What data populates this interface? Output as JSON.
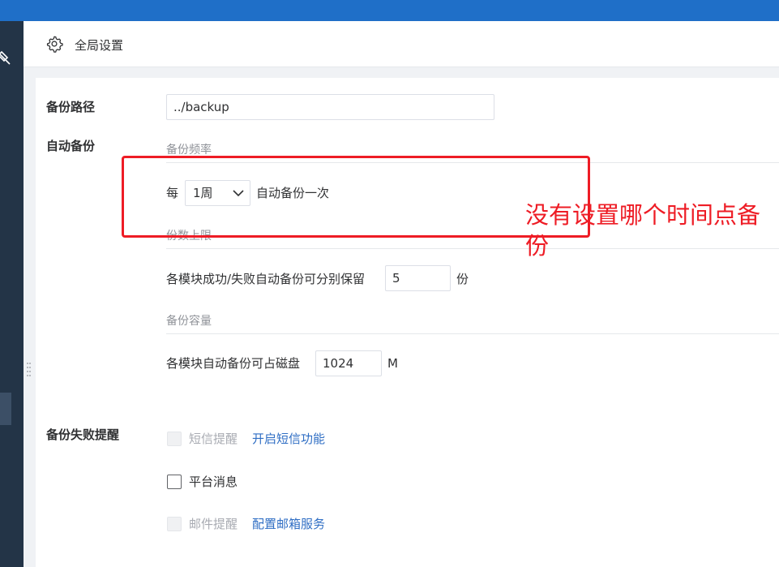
{
  "header": {
    "title": "全局设置",
    "icon": "gear-icon"
  },
  "form": {
    "backup_path": {
      "label": "备份路径",
      "value": "../backup"
    },
    "auto_backup": {
      "label": "自动备份",
      "frequency": {
        "section": "备份频率",
        "prefix": "每",
        "selected": "1周",
        "suffix": "自动备份一次"
      },
      "count_limit": {
        "section": "份数上限",
        "prefix": "各模块成功/失败自动备份可分别保留",
        "value": "5",
        "unit": "份"
      },
      "capacity": {
        "section": "备份容量",
        "prefix": "各模块自动备份可占磁盘",
        "value": "1024",
        "unit": "M"
      }
    },
    "failure_alert": {
      "label": "备份失败提醒",
      "sms": {
        "label": "短信提醒",
        "link": "开启短信功能",
        "disabled": true,
        "checked": false
      },
      "platform": {
        "label": "平台消息",
        "checked": false
      },
      "email": {
        "label": "邮件提醒",
        "link": "配置邮箱服务",
        "disabled": true,
        "checked": false
      }
    }
  },
  "annotation": {
    "text": "没有设置哪个时间点备份"
  },
  "colors": {
    "topbar": "#1f6fc8",
    "sidebar": "#233447",
    "link": "#2f6ec4",
    "annotation": "#ee1c25"
  }
}
